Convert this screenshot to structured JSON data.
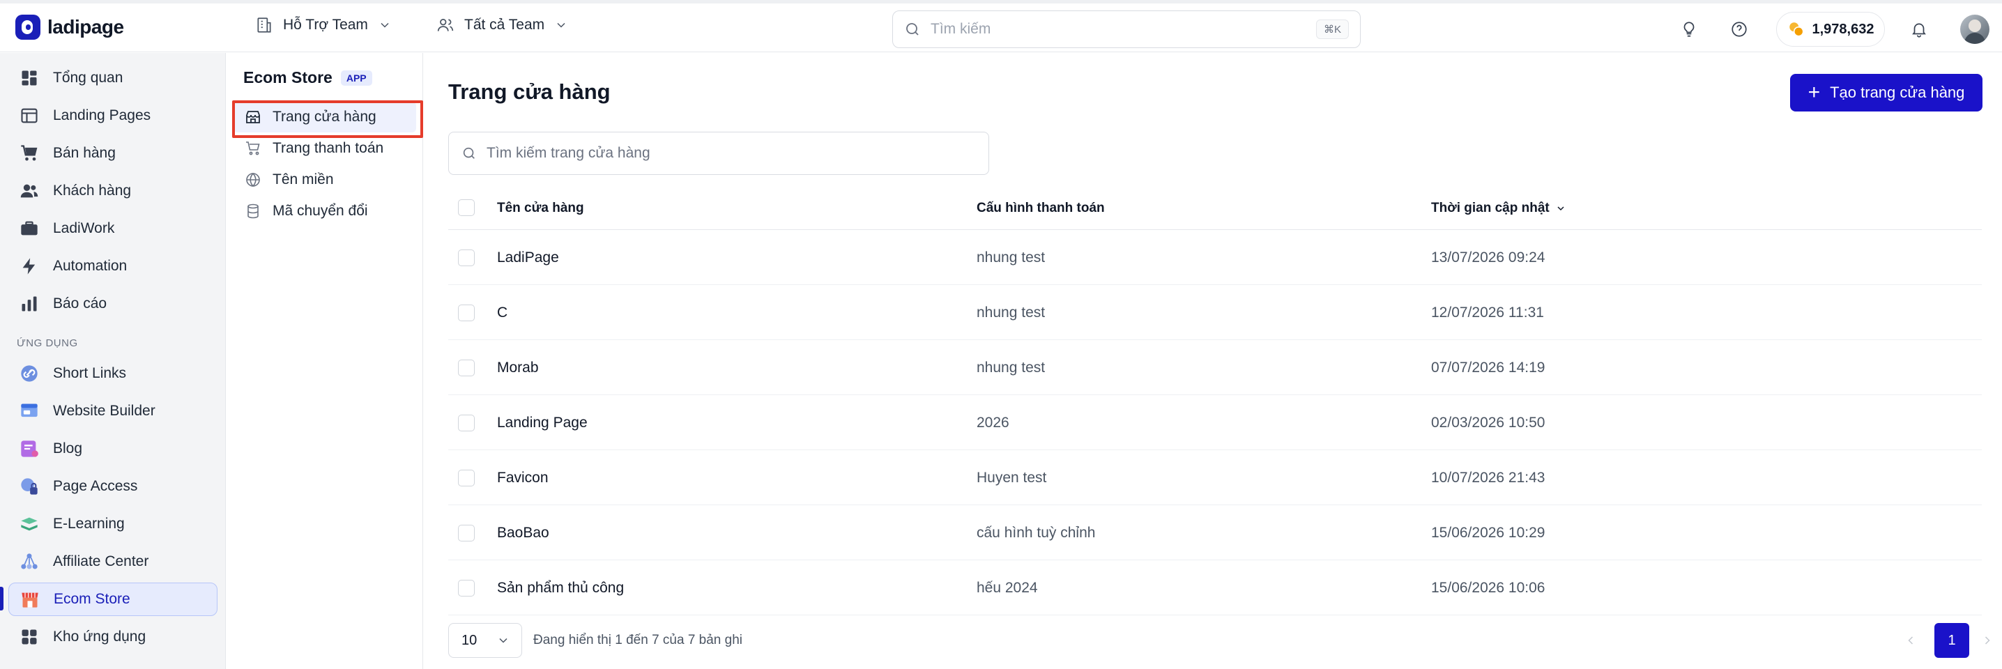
{
  "app": {
    "logo_text": "ladipage"
  },
  "header": {
    "team_selector": "Hỗ Trợ Team",
    "team_filter": "Tất cả Team",
    "search_placeholder": "Tìm kiếm",
    "search_shortcut": "⌘K",
    "credits": "1,978,632"
  },
  "sidebar": {
    "items": [
      {
        "label": "Tổng quan",
        "icon": "dashboard-icon"
      },
      {
        "label": "Landing Pages",
        "icon": "layout-icon"
      },
      {
        "label": "Bán hàng",
        "icon": "cart-icon"
      },
      {
        "label": "Khách hàng",
        "icon": "users-icon"
      },
      {
        "label": "LadiWork",
        "icon": "briefcase-icon"
      },
      {
        "label": "Automation",
        "icon": "bolt-icon"
      },
      {
        "label": "Báo cáo",
        "icon": "bar-chart-icon"
      }
    ],
    "section_label": "ỨNG DỤNG",
    "apps": [
      {
        "label": "Short Links",
        "icon": "link-icon"
      },
      {
        "label": "Website Builder",
        "icon": "website-icon"
      },
      {
        "label": "Blog",
        "icon": "blog-icon"
      },
      {
        "label": "Page Access",
        "icon": "lock-icon"
      },
      {
        "label": "E-Learning",
        "icon": "book-icon"
      },
      {
        "label": "Affiliate Center",
        "icon": "network-icon"
      },
      {
        "label": "Ecom Store",
        "icon": "store-icon"
      },
      {
        "label": "Kho ứng dụng",
        "icon": "grid-icon"
      }
    ]
  },
  "subnav": {
    "title": "Ecom Store",
    "badge": "APP",
    "items": [
      {
        "label": "Trang cửa hàng",
        "icon": "storefront-icon"
      },
      {
        "label": "Trang thanh toán",
        "icon": "cart-icon"
      },
      {
        "label": "Tên miền",
        "icon": "globe-icon"
      },
      {
        "label": "Mã chuyển đổi",
        "icon": "database-icon"
      }
    ]
  },
  "main": {
    "title": "Trang cửa hàng",
    "create_button": "Tạo trang cửa hàng",
    "search_placeholder": "Tìm kiếm trang cửa hàng",
    "columns": {
      "name": "Tên cửa hàng",
      "payment": "Cấu hình thanh toán",
      "updated": "Thời gian cập nhật"
    },
    "rows": [
      {
        "name": "LadiPage",
        "payment": "nhung test",
        "updated": "13/07/2026 09:24"
      },
      {
        "name": "C",
        "payment": "nhung test",
        "updated": "12/07/2026 11:31"
      },
      {
        "name": "Morab",
        "payment": "nhung test",
        "updated": "07/07/2026 14:19"
      },
      {
        "name": "Landing Page",
        "payment": "2026",
        "updated": "02/03/2026 10:50"
      },
      {
        "name": "Favicon",
        "payment": "Huyen test",
        "updated": "10/07/2026 21:43"
      },
      {
        "name": "BaoBao",
        "payment": "cấu hình tuỳ chỉnh",
        "updated": "15/06/2026 10:29"
      },
      {
        "name": "Sản phẩm thủ công",
        "payment": "hếu 2024",
        "updated": "15/06/2026 10:06"
      }
    ],
    "footer": {
      "page_size": "10",
      "summary": "Đang hiển thị 1 đến 7 của 7 bản ghi",
      "current_page": "1"
    }
  },
  "colors": {
    "accent": "#1a12c9",
    "highlight": "#e53c2b"
  }
}
